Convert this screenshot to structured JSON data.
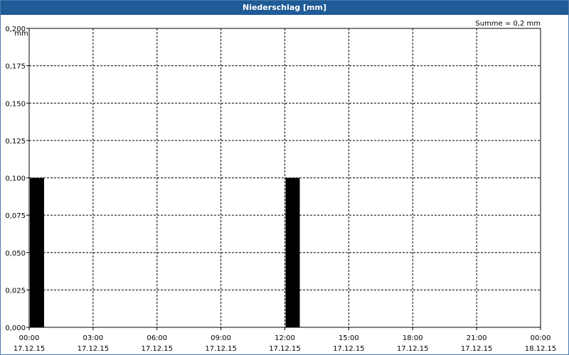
{
  "window": {
    "title": "Niederschlag [mm]"
  },
  "summary": "Summe = 0,2 mm",
  "chart_data": {
    "type": "bar",
    "title": "Niederschlag [mm]",
    "ylabel": "mm",
    "ylim": [
      0,
      0.2
    ],
    "y_ticks": [
      "0,000",
      "0,025",
      "0,050",
      "0,075",
      "0,100",
      "0,125",
      "0,150",
      "0,175",
      "0,200"
    ],
    "x_range_hours": [
      0,
      24
    ],
    "x_ticks": [
      {
        "time": "00:00",
        "date": "17.12.15"
      },
      {
        "time": "03:00",
        "date": "17.12.15"
      },
      {
        "time": "06:00",
        "date": "17.12.15"
      },
      {
        "time": "09:00",
        "date": "17.12.15"
      },
      {
        "time": "12:00",
        "date": "17.12.15"
      },
      {
        "time": "15:00",
        "date": "17.12.15"
      },
      {
        "time": "18:00",
        "date": "17.12.15"
      },
      {
        "time": "21:00",
        "date": "17.12.15"
      },
      {
        "time": "00:00",
        "date": "18.12.15"
      }
    ],
    "series": [
      {
        "values": [
          {
            "start": "17.12.15 00:00",
            "end": "17.12.15 00:40",
            "value": 0.1
          },
          {
            "start": "17.12.15 12:00",
            "end": "17.12.15 12:40",
            "value": 0.1
          }
        ]
      }
    ],
    "grid": true,
    "colors": {
      "bar": "#000000",
      "grid": "#000000",
      "title_bar": "#1f5b96"
    }
  }
}
